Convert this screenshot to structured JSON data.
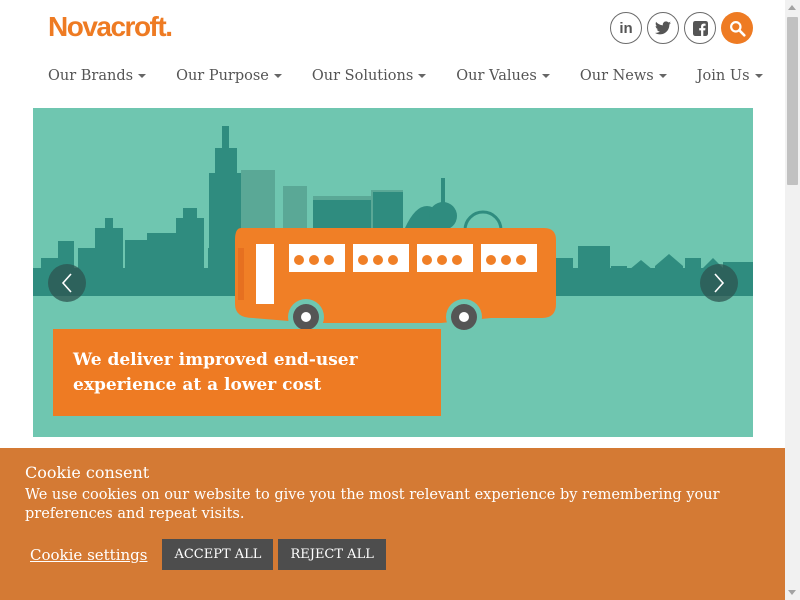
{
  "brand": {
    "logo_text": "Novacroft.",
    "accent": "#ee7b23"
  },
  "social": [
    {
      "icon": "linkedin-icon",
      "label": "in"
    },
    {
      "icon": "twitter-icon"
    },
    {
      "icon": "facebook-icon"
    },
    {
      "icon": "search-icon"
    }
  ],
  "nav": {
    "items": [
      {
        "label": "Our Brands"
      },
      {
        "label": "Our Purpose"
      },
      {
        "label": "Our Solutions"
      },
      {
        "label": "Our Values"
      },
      {
        "label": "Our News"
      },
      {
        "label": "Join Us"
      }
    ]
  },
  "hero": {
    "caption": "We deliver improved end-user experience at a lower cost",
    "background": "#6fc6b0",
    "skyline_color": "#2f8c7f",
    "bus_color": "#f07f26"
  },
  "cookie": {
    "title": "Cookie consent",
    "text": "We use cookies on our website to give you the most relevant experience by remembering your preferences and repeat visits.",
    "settings_label": "Cookie settings",
    "accept_label": "ACCEPT ALL",
    "reject_label": "REJECT ALL",
    "background": "#d47a34"
  }
}
